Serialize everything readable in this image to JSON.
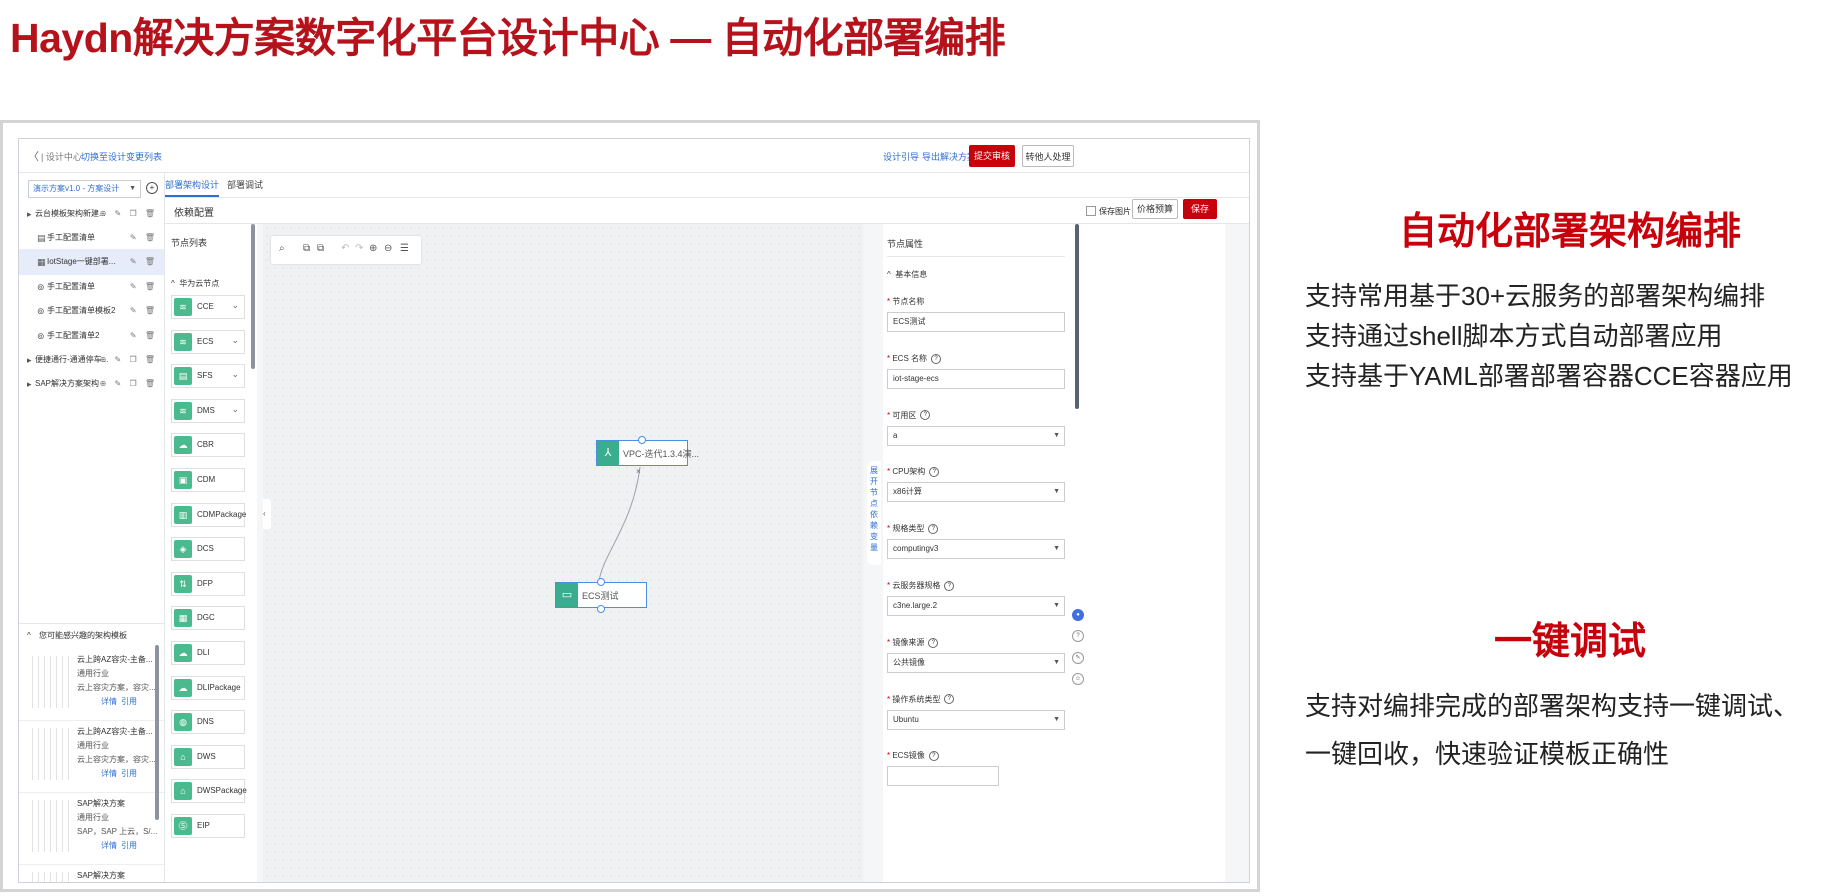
{
  "slide": {
    "title": "Haydn解决方案数字化平台设计中心 — 自动化部署编排"
  },
  "topbar": {
    "back": "〈",
    "breadcrumb": "| 设计中心",
    "switch_link": "切换至设计变更列表",
    "guide_link": "设计引导",
    "export_link": "导出解决方案",
    "submit_label": "提交审核",
    "transfer_label": "转他人处理"
  },
  "sidebar": {
    "scheme_select": "演示方案v1.0 - 方案设计",
    "tree": [
      {
        "label": "云台模板架构新建...",
        "icon": "▸",
        "actions": "⊕ ✎ ❐ 🗑"
      },
      {
        "label": "手工配置清单",
        "icon": "▤",
        "actions": "✎ 🗑"
      },
      {
        "label": "IotStage一键部署...",
        "icon": "▦",
        "actions": "✎ 🗑"
      },
      {
        "label": "手工配置清单",
        "icon": "⊚",
        "actions": "✎ 🗑"
      },
      {
        "label": "手工配置清单模板2",
        "icon": "⊚",
        "actions": "✎ 🗑"
      },
      {
        "label": "手工配置清单2",
        "icon": "⊚",
        "actions": "✎ 🗑"
      },
      {
        "label": "便捷通行-通通停车...",
        "icon": "▸",
        "actions": "⊕ ✎ ❐ 🗑"
      },
      {
        "label": "SAP解决方案架构",
        "icon": "▸",
        "actions": "⊕ ✎ ❐ 🗑"
      }
    ],
    "templates_header": "您可能感兴趣的架构模板",
    "templates": [
      {
        "title": "云上跨AZ容灾-主备...",
        "industry": "通用行业",
        "desc": "云上容灾方案，容灾...",
        "detail": "详情",
        "cite": "引用"
      },
      {
        "title": "云上跨AZ容灾-主备...",
        "industry": "通用行业",
        "desc": "云上容灾方案，容灾...",
        "detail": "详情",
        "cite": "引用"
      },
      {
        "title": "SAP解决方案",
        "industry": "通用行业",
        "desc": "SAP，SAP 上云，S/...",
        "detail": "详情",
        "cite": "引用"
      },
      {
        "title": "SAP解决方案",
        "industry": "",
        "desc": "",
        "detail": "",
        "cite": ""
      }
    ]
  },
  "tabs": [
    {
      "label": "部署架构设计"
    },
    {
      "label": "部署调试"
    }
  ],
  "deploy_bar": {
    "title": "依赖配置",
    "save_image": "保存图片",
    "estimate": "价格预算",
    "save": "保存"
  },
  "node_list": {
    "title": "节点列表",
    "group": "华为云节点",
    "items": [
      {
        "label": "CCE",
        "icon": "layers-icon",
        "glyph": "≋",
        "expandable": true
      },
      {
        "label": "ECS",
        "icon": "layers-icon",
        "glyph": "≋",
        "expandable": true
      },
      {
        "label": "SFS",
        "icon": "file-icon",
        "glyph": "▤",
        "expandable": true
      },
      {
        "label": "DMS",
        "icon": "layers-icon",
        "glyph": "≋",
        "expandable": true
      },
      {
        "label": "CBR",
        "icon": "backup-icon",
        "glyph": "☁",
        "expandable": false
      },
      {
        "label": "CDM",
        "icon": "cdm-icon",
        "glyph": "▣",
        "expandable": false
      },
      {
        "label": "CDMPackage",
        "icon": "package-icon",
        "glyph": "▥",
        "expandable": false
      },
      {
        "label": "DCS",
        "icon": "cache-icon",
        "glyph": "◈",
        "expandable": false
      },
      {
        "label": "DFP",
        "icon": "flow-icon",
        "glyph": "⇅",
        "expandable": false
      },
      {
        "label": "DGC",
        "icon": "dgc-icon",
        "glyph": "▦",
        "expandable": false
      },
      {
        "label": "DLI",
        "icon": "cloud-icon",
        "glyph": "☁",
        "expandable": false
      },
      {
        "label": "DLIPackage",
        "icon": "cloud-icon",
        "glyph": "☁",
        "expandable": false
      },
      {
        "label": "DNS",
        "icon": "dns-icon",
        "glyph": "◍",
        "expandable": false
      },
      {
        "label": "DWS",
        "icon": "warehouse-icon",
        "glyph": "⌂",
        "expandable": false
      },
      {
        "label": "DWSPackage",
        "icon": "warehouse-icon",
        "glyph": "⌂",
        "expandable": false
      },
      {
        "label": "EIP",
        "icon": "ip-icon",
        "glyph": "⓹",
        "expandable": false
      }
    ]
  },
  "canvas": {
    "collapse": "‹",
    "tools": [
      "⌕",
      "⧉",
      "⧉",
      "↶",
      "↷",
      "⊕",
      "⊖",
      "☰"
    ],
    "nodes": [
      {
        "label": "VPC-迭代1.3.4演...",
        "glyph": "⅄"
      },
      {
        "label": "ECS测试",
        "glyph": "▭"
      }
    ],
    "deps_handle": "展开节点依赖变量"
  },
  "properties": {
    "title": "节点属性",
    "section": "基本信息",
    "fields": [
      {
        "label": "节点名称",
        "required": true,
        "help": false,
        "value": "ECS测试",
        "select": false
      },
      {
        "label": "ECS 名称",
        "required": true,
        "help": true,
        "value": "iot-stage-ecs",
        "select": false
      },
      {
        "label": "可用区",
        "required": true,
        "help": true,
        "value": "a",
        "select": true
      },
      {
        "label": "CPU架构",
        "required": true,
        "help": true,
        "value": "x86计算",
        "select": true
      },
      {
        "label": "规格类型",
        "required": true,
        "help": true,
        "value": "computingv3",
        "select": true
      },
      {
        "label": "云服务器规格",
        "required": true,
        "help": true,
        "value": "c3ne.large.2",
        "select": true
      },
      {
        "label": "镜像来源",
        "required": true,
        "help": true,
        "value": "公共镜像",
        "select": true
      },
      {
        "label": "操作系统类型",
        "required": true,
        "help": true,
        "value": "Ubuntu",
        "select": true
      },
      {
        "label": "ECS镜像",
        "required": true,
        "help": true,
        "value": "",
        "select": true
      }
    ]
  },
  "features": [
    {
      "title": "自动化部署架构编排",
      "lines": [
        "支持常用基于30+云服务的部署架构编排",
        "支持通过shell脚本方式自动部署应用",
        "支持基于YAML部署部署容器CCE容器应用"
      ]
    },
    {
      "title": "一键调试",
      "lines": [
        "支持对编排完成的部署架构支持一键调试、",
        "一键回收，快速验证模板正确性"
      ]
    }
  ],
  "colors": {
    "brand_red": "#c7000b",
    "title_red": "#b5121b",
    "link_blue": "#2f6fd0",
    "node_green": "#4cba8f"
  }
}
